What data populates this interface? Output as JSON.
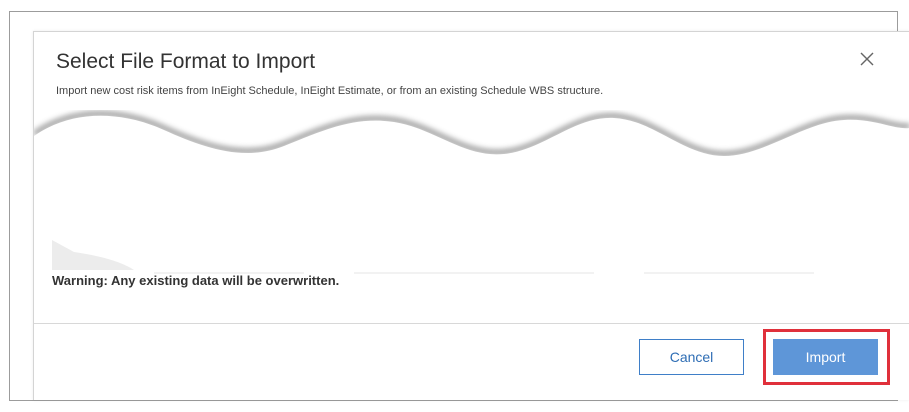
{
  "dialog": {
    "title": "Select File Format to Import",
    "subtitle": "Import new cost risk items from InEight Schedule, InEight Estimate, or from an existing Schedule WBS structure.",
    "close_icon": "close-icon",
    "warning": "Warning: Any existing data will be overwritten.",
    "buttons": {
      "cancel_label": "Cancel",
      "import_label": "Import"
    }
  },
  "colors": {
    "primary": "#5e96d8",
    "secondary_border": "#3f7fc8",
    "highlight": "#e0303b",
    "text": "#333333"
  }
}
